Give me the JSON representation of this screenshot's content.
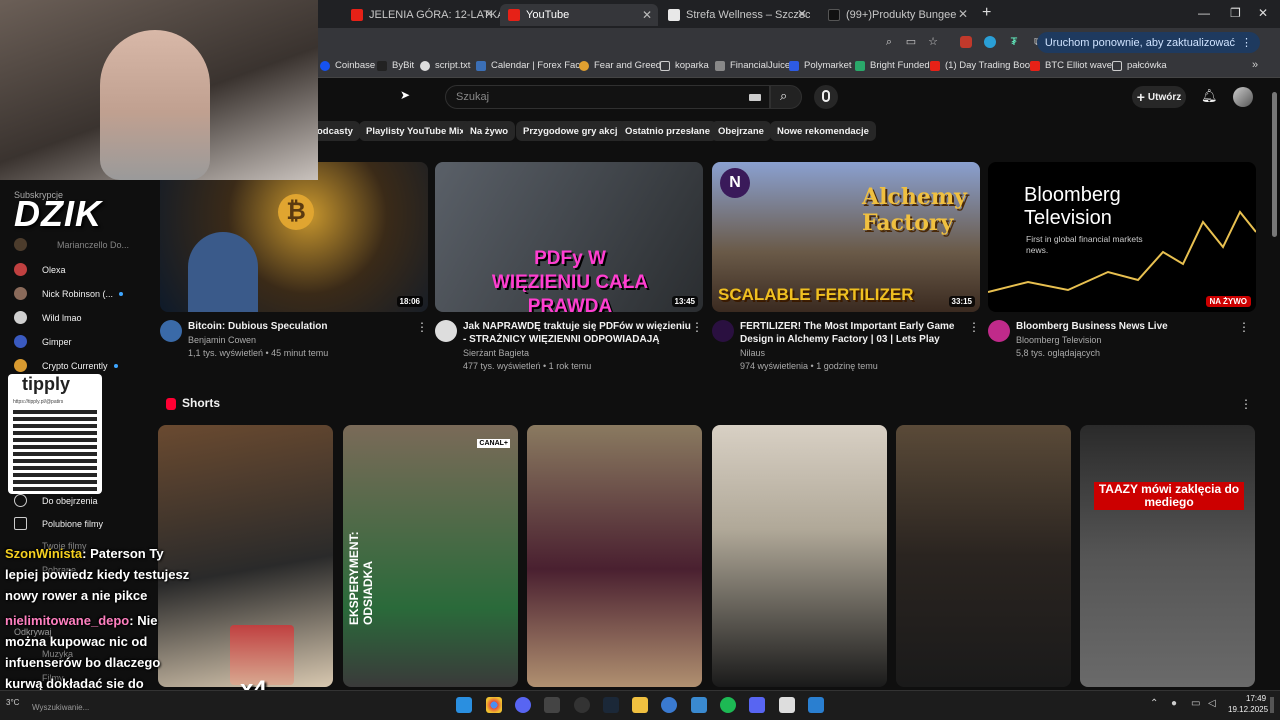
{
  "browser": {
    "tabs": [
      {
        "label": "JELENIA GÓRA: 12-LATKA ZAM",
        "favicon": "youtube-icon",
        "active": false
      },
      {
        "label": "YouTube",
        "favicon": "youtube-icon",
        "active": true
      },
      {
        "label": "Strefa Wellness – Szczecin | Bałt",
        "favicon": "page-icon",
        "active": false
      },
      {
        "label": "(99+)Produkty Bungee i Pizza B",
        "favicon": "tiktok-icon",
        "active": false
      }
    ],
    "update_button": "Uruchom ponownie, aby zaktualizować",
    "bookmarks": [
      "Coinbase",
      "ByBit",
      "script.txt",
      "Calendar | Forex Fac...",
      "Fear and Greed",
      "koparka",
      "FinancialJuice",
      "Polymarket",
      "Bright Funded",
      "(1) Day Trading Boo...",
      "BTC Elliot wave",
      "pałcówka"
    ]
  },
  "youtube": {
    "search_placeholder": "Szukaj",
    "create_label": "Utwórz",
    "chips": [
      "odcasty",
      "Playlisty YouTube Mix",
      "Na żywo",
      "Przygodowe gry akcji",
      "Ostatnio przesłane",
      "Obejrzane",
      "Nowe rekomendacje"
    ],
    "videos": [
      {
        "title": "Bitcoin: Dubious Speculation",
        "channel": "Benjamin Cowen",
        "stats": "1,1 tys. wyświetleń • 45 minut temu",
        "duration": "18:06",
        "thumb_colors": [
          "#1a2a3c",
          "#b88a2a"
        ]
      },
      {
        "title": "Jak NAPRAWDĘ traktuje się PDFów w więzieniu - STRAŻNICY WIĘZIENNI ODPOWIADAJĄ",
        "channel": "Sierżant Bagieta",
        "stats": "477 tys. wyświetleń • 1 rok temu",
        "duration": "13:45",
        "thumb_text": "PDFy W WIĘZIENIU CAŁA PRAWDA",
        "thumb_colors": [
          "#4a4f55",
          "#2a2d30"
        ]
      },
      {
        "title": "FERTILIZER! The Most Important Early Game Design in Alchemy Factory | 03 | Lets Play",
        "channel": "Nilaus",
        "stats": "974 wyświetlenia • 1 godzinę temu",
        "duration": "33:15",
        "thumb_text": "SCALABLE FERTILIZER",
        "thumb_colors": [
          "#6a7fb5",
          "#5a4a3a"
        ]
      },
      {
        "title": "Bloomberg Business News Live",
        "channel": "Bloomberg Television",
        "stats": "5,8 tys. oglądających",
        "live_badge": "NA ŻYWO",
        "thumb_text": "Bloomberg Television",
        "thumb_sub": "First in global financial markets news.",
        "thumb_colors": [
          "#000000",
          "#1a1a1a"
        ]
      }
    ],
    "shorts_title": "Shorts",
    "shorts": [
      {
        "colors": [
          "#5a3a2a",
          "#d8c8b0"
        ]
      },
      {
        "colors": [
          "#6a5a4a",
          "#2a6a3a"
        ],
        "overlay": "EKSPERYMENT: ODSIADKA",
        "badge": "CANAL+"
      },
      {
        "colors": [
          "#7a6a55",
          "#4a2030"
        ]
      },
      {
        "colors": [
          "#d0c8bc",
          "#2a2a2a"
        ]
      },
      {
        "colors": [
          "#4a4035",
          "#1a1a1a"
        ]
      },
      {
        "colors": [
          "#222222",
          "#6a6a6a"
        ],
        "overlay": "TAAZY mówi zaklęcia do mediego"
      }
    ],
    "sidebar": {
      "section": "Subskrypcje",
      "items": [
        {
          "label": "Marianczello Do...",
          "color": "#8a6a4a",
          "dim": true
        },
        {
          "label": "Olexa",
          "color": "#c04040"
        },
        {
          "label": "Nick Robinson (...",
          "color": "#8a6a5a",
          "live": true
        },
        {
          "label": "Wild lmao",
          "color": "#d0d0d0"
        },
        {
          "label": "Gimper",
          "color": "#3a5ac0"
        },
        {
          "label": "Crypto Currently",
          "color": "#d89a30",
          "live": true
        },
        {
          "label": "Do obejrzenia",
          "color": "#888888"
        },
        {
          "label": "Polubione filmy",
          "color": "#888888"
        },
        {
          "label": "Twoje filmy",
          "color": "#888888",
          "dim": true
        },
        {
          "label": "Pobrane",
          "color": "#888888",
          "dim": true
        },
        {
          "label": "Odkrywaj",
          "color": "#888888",
          "dim": true
        },
        {
          "label": "Muzyka",
          "color": "#888888",
          "dim": true
        },
        {
          "label": "Filmy",
          "color": "#888888",
          "dim": true
        }
      ]
    }
  },
  "stream": {
    "logo": "DZIK",
    "tipply": "tipply",
    "tipply_url": "https://tipply.pl/@patirs",
    "chat": [
      {
        "user": "SzonWinista",
        "message": ": Paterson Ty lepiej powiedz kiedy testujesz nowy rower a nie pikce"
      },
      {
        "user": "nielimitowane_depo",
        "message": ": Nie można kupowac nic od infuenserów bo dlaczego kurwą dokładać sie do budżetu."
      }
    ],
    "multiplier": "x4",
    "footer_text": "Wyszukiwanie...",
    "weather": "3°C"
  },
  "taskbar": {
    "time": "17:49",
    "date": "19.12.2025"
  }
}
